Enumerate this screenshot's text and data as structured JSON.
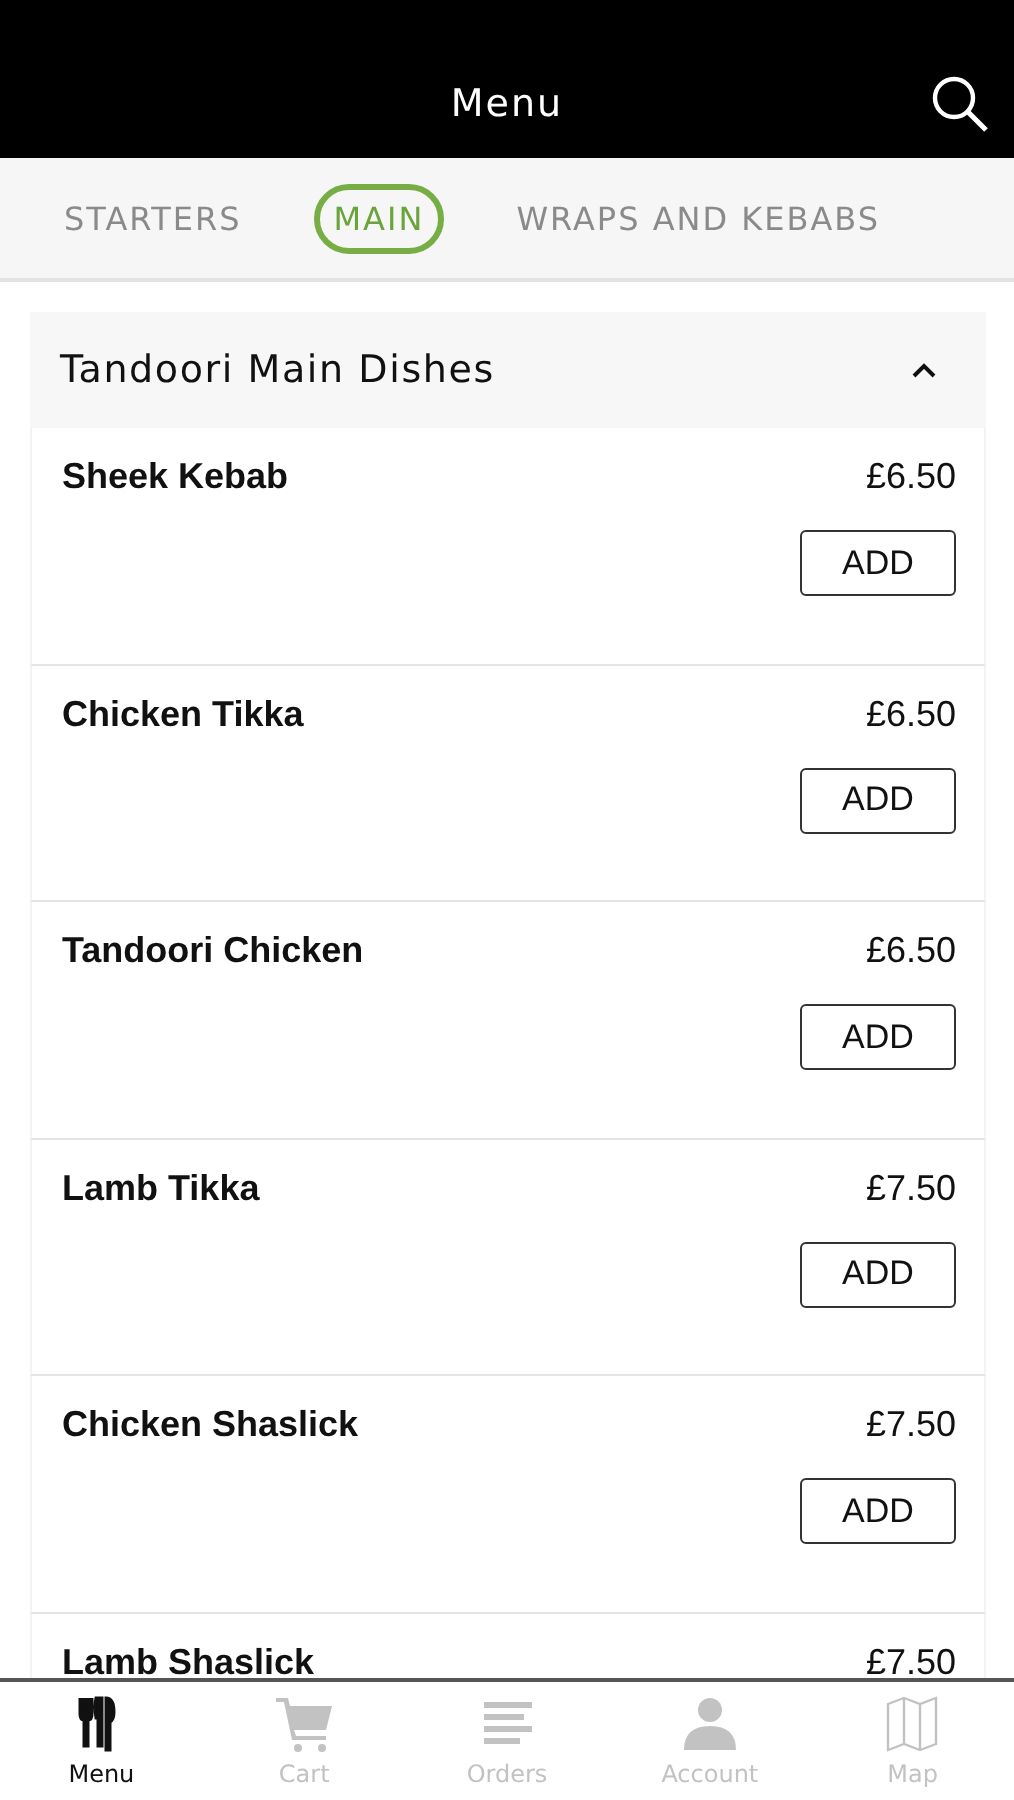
{
  "header": {
    "title": "Menu"
  },
  "tabs": [
    {
      "label": "STARTERS",
      "selected": false
    },
    {
      "label": "MAIN",
      "selected": true
    },
    {
      "label": "WRAPS AND KEBABS",
      "selected": false
    }
  ],
  "section": {
    "title": "Tandoori Main Dishes",
    "expanded": true
  },
  "items": [
    {
      "name": "Sheek Kebab",
      "price": "£6.50",
      "button": "ADD"
    },
    {
      "name": "Chicken Tikka",
      "price": "£6.50",
      "button": "ADD"
    },
    {
      "name": "Tandoori Chicken",
      "price": "£6.50",
      "button": "ADD"
    },
    {
      "name": "Lamb Tikka",
      "price": "£7.50",
      "button": "ADD"
    },
    {
      "name": "Chicken Shaslick",
      "price": "£7.50",
      "button": "ADD"
    },
    {
      "name": "Lamb Shaslick",
      "price": "£7.50"
    }
  ],
  "nav": [
    {
      "kind": "menu",
      "label": "Menu",
      "selected": true
    },
    {
      "kind": "cart",
      "label": "Cart",
      "selected": false
    },
    {
      "kind": "orders",
      "label": "Orders",
      "selected": false
    },
    {
      "kind": "account",
      "label": "Account",
      "selected": false
    },
    {
      "kind": "map",
      "label": "Map",
      "selected": false
    }
  ]
}
